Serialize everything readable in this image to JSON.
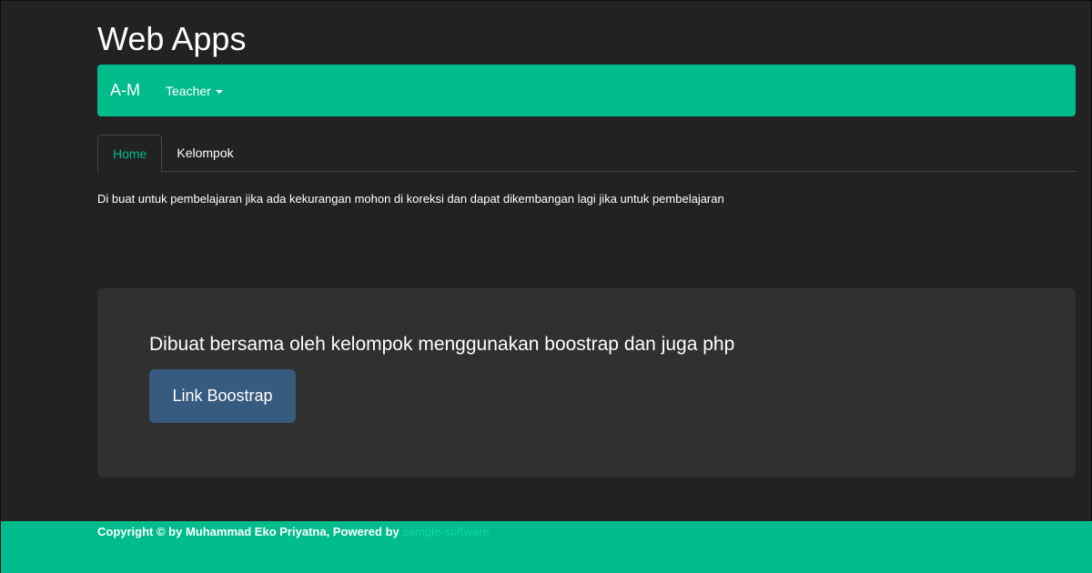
{
  "header": {
    "title": "Web Apps"
  },
  "navbar": {
    "brand": "A-M",
    "dropdown_label": "Teacher",
    "background": "#00bc8c"
  },
  "tabs": [
    {
      "label": "Home",
      "active": true
    },
    {
      "label": "Kelompok",
      "active": false
    }
  ],
  "intro_text": "Di buat untuk pembelajaran jika ada kekurangan mohon di koreksi dan dapat dikembangan lagi jika untuk pembelajaran",
  "jumbotron": {
    "text": "Dibuat bersama oleh kelompok menggunakan boostrap dan juga php",
    "button_label": "Link Boostrap",
    "button_color": "#375a7f"
  },
  "footer": {
    "text_prefix": "Copyright © by Muhammad Eko Priyatna, Powered by ",
    "link_text": "sample-software",
    "background": "#00bc8c"
  },
  "icons": {
    "dropdown": "caret-down-icon"
  }
}
